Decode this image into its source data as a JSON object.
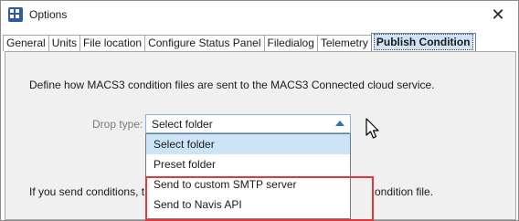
{
  "window": {
    "title": "Options",
    "close_glyph": "✕"
  },
  "tabs": [
    {
      "label": "General",
      "active": false
    },
    {
      "label": "Units",
      "active": false
    },
    {
      "label": "File location",
      "active": false
    },
    {
      "label": "Configure Status Panel",
      "active": false
    },
    {
      "label": "Filedialog",
      "active": false
    },
    {
      "label": "Telemetry",
      "active": false
    },
    {
      "label": "Publish Condition",
      "active": true
    }
  ],
  "panel": {
    "description": "Define how MACS3 condition files are sent to the MACS3 Connected cloud service.",
    "drop_type_label": "Drop type:",
    "drop_type_value": "Select folder",
    "options": [
      "Select folder",
      "Preset folder",
      "Send to custom SMTP server",
      "Send to Navis API"
    ],
    "footer_text_start": "If you send conditions, t",
    "footer_text_end": "ondition file."
  },
  "colors": {
    "highlight": "#e0393b",
    "selection": "#cce4f7",
    "accent": "#2c6fbf"
  }
}
